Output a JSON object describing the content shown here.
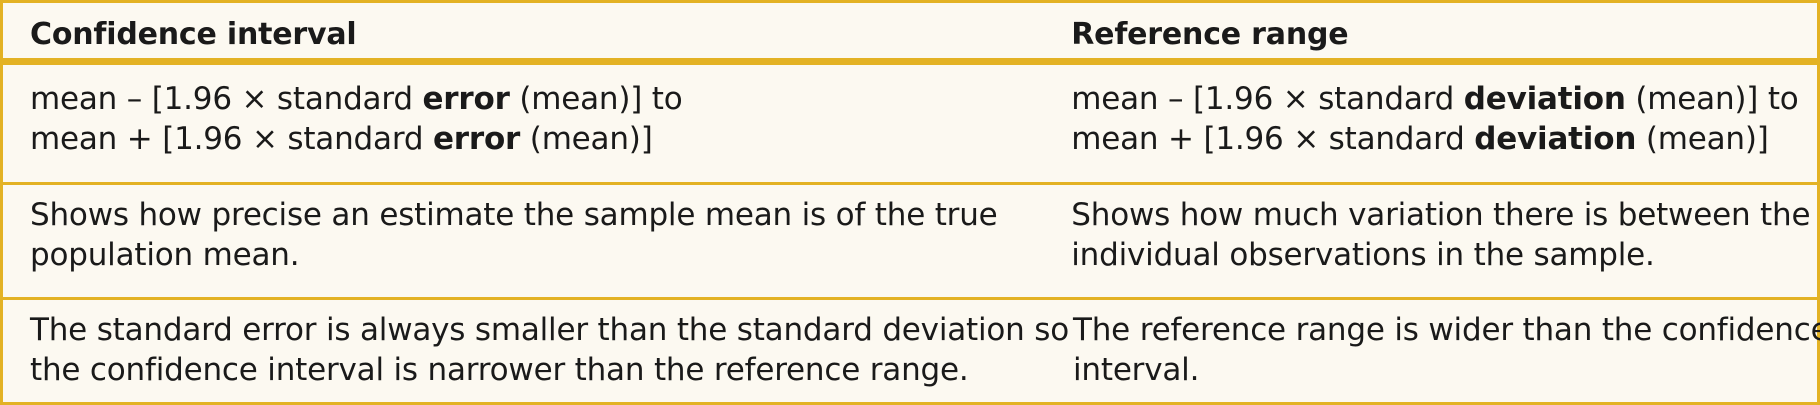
{
  "header": {
    "left": "Confidence interval",
    "right": "Reference range"
  },
  "rows": [
    {
      "left": {
        "line1": {
          "pre": "mean – [1.96 × standard ",
          "bold": "error",
          "post": " (mean)] to"
        },
        "line2": {
          "pre": "mean + [1.96 × standard ",
          "bold": "error",
          "post": " (mean)]"
        }
      },
      "right": {
        "line1": {
          "pre": "mean – [1.96 × standard ",
          "bold": "deviation",
          "post": " (mean)] to"
        },
        "line2": {
          "pre": "mean + [1.96 × standard ",
          "bold": "deviation",
          "post": " (mean)]"
        }
      }
    },
    {
      "left": {
        "line1": "Shows how precise an estimate the sample mean is of the true",
        "line2": "population mean."
      },
      "right": {
        "line1": "Shows how much variation there is between the",
        "line2": "individual observations in the sample."
      }
    },
    {
      "left": {
        "line1": "The standard error is always smaller than the standard deviation so",
        "line2": "the confidence interval is narrower than the reference range."
      },
      "right": {
        "line1": "The reference range is wider than the confidence",
        "line2": "interval."
      }
    }
  ],
  "colors": {
    "border": "#e3b224",
    "background": "#fcf9f1"
  }
}
